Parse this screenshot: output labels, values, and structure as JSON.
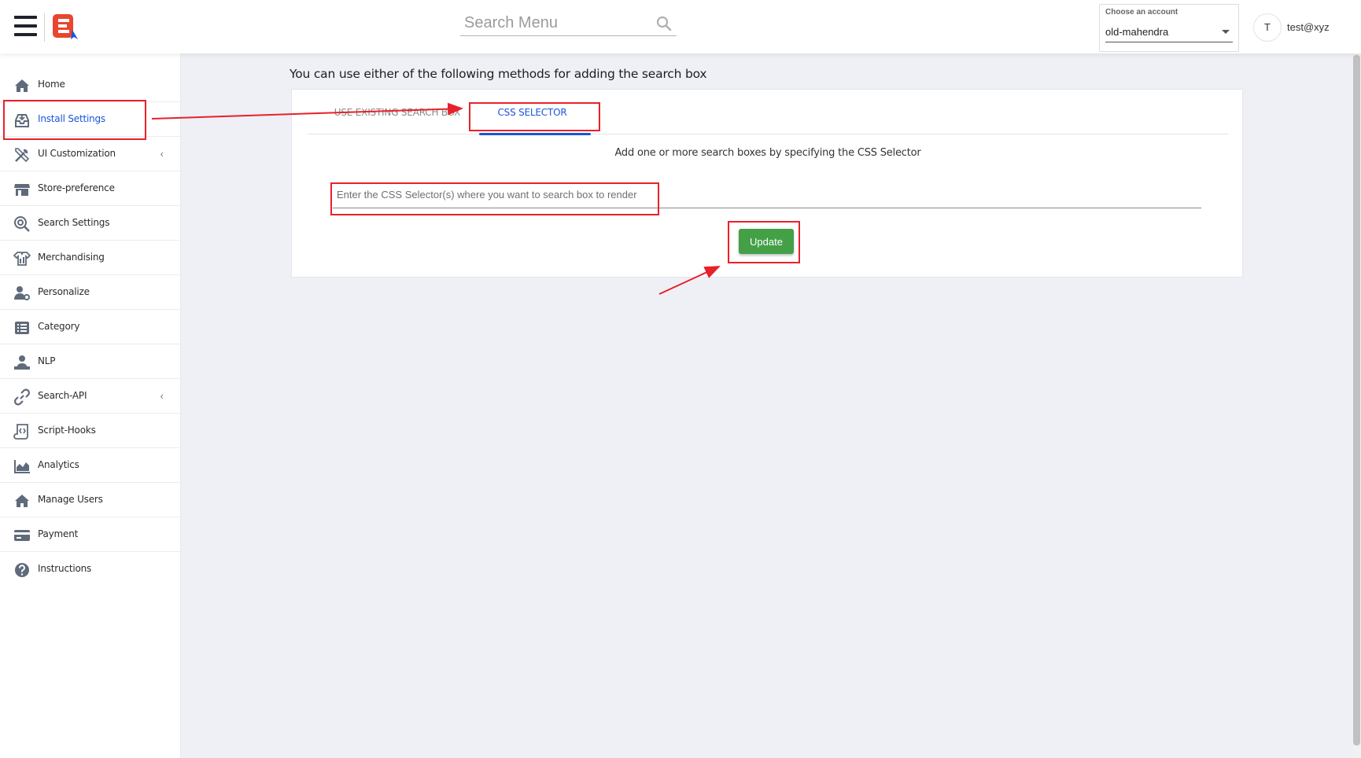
{
  "header": {
    "menu_search_placeholder": "Search Menu",
    "account": {
      "label": "Choose an account",
      "selected": "old-mahendra"
    },
    "user": {
      "avatar_initial": "T",
      "email": "test@xyz"
    }
  },
  "sidebar": {
    "items": [
      {
        "label": "Home",
        "icon": "home-icon"
      },
      {
        "label": "Install Settings",
        "icon": "install-icon",
        "active": true
      },
      {
        "label": "UI Customization",
        "icon": "ui-tools-icon",
        "has_submenu": true
      },
      {
        "label": "Store-preference",
        "icon": "store-icon"
      },
      {
        "label": "Search Settings",
        "icon": "search-settings-icon"
      },
      {
        "label": "Merchandising",
        "icon": "merchandising-icon"
      },
      {
        "label": "Personalize",
        "icon": "personalize-icon"
      },
      {
        "label": "Category",
        "icon": "category-list-icon"
      },
      {
        "label": "NLP",
        "icon": "nlp-icon"
      },
      {
        "label": "Search-API",
        "icon": "link-icon",
        "has_submenu": true
      },
      {
        "label": "Script-Hooks",
        "icon": "script-icon"
      },
      {
        "label": "Analytics",
        "icon": "analytics-icon"
      },
      {
        "label": "Manage Users",
        "icon": "manage-users-icon"
      },
      {
        "label": "Payment",
        "icon": "payment-card-icon"
      },
      {
        "label": "Instructions",
        "icon": "help-circle-icon"
      }
    ],
    "chevron": "‹"
  },
  "main": {
    "heading": "You can use either of the following methods for adding the search box",
    "tabs": [
      {
        "label": "USE EXISTING SEARCH BOX",
        "active": false
      },
      {
        "label": "CSS SELECTOR",
        "active": true
      }
    ],
    "hint": "Add one or more search boxes by specifying the CSS Selector",
    "selector_placeholder": "Enter the CSS Selector(s) where you want to search box to render",
    "selector_value": "",
    "update_label": "Update"
  },
  "colors": {
    "accent": "#1a56db",
    "update_button": "#43a047",
    "annotation": "#e8212a",
    "brand": "#e8462e"
  }
}
